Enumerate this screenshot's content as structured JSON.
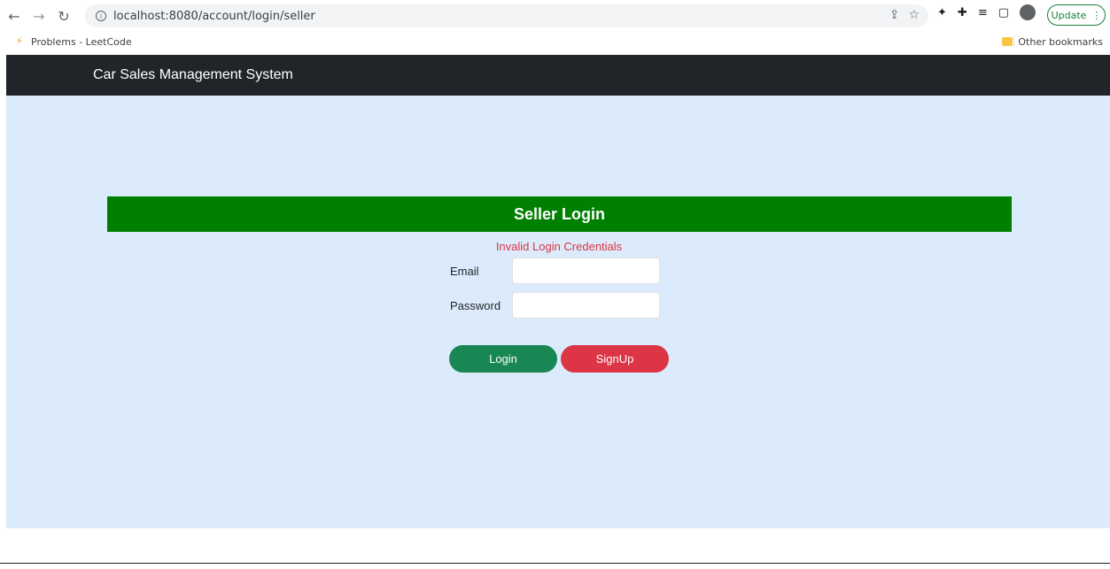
{
  "browser": {
    "url": "localhost:8080/account/login/seller",
    "update_label": "Update",
    "bookmarks": [
      {
        "label": "Problems - LeetCode"
      }
    ],
    "other_bookmarks_label": "Other bookmarks"
  },
  "navbar": {
    "brand": "Car Sales Management System"
  },
  "login": {
    "title": "Seller Login",
    "error": "Invalid Login Credentials",
    "email_label": "Email",
    "email_value": "",
    "password_label": "Password",
    "password_value": "",
    "login_button": "Login",
    "signup_button": "SignUp"
  },
  "colors": {
    "navbar": "#212529",
    "page_bg": "#dbebfb",
    "header_bg": "#008000",
    "login_btn": "#198754",
    "signup_btn": "#dc3545",
    "error_text": "#dc3545"
  }
}
